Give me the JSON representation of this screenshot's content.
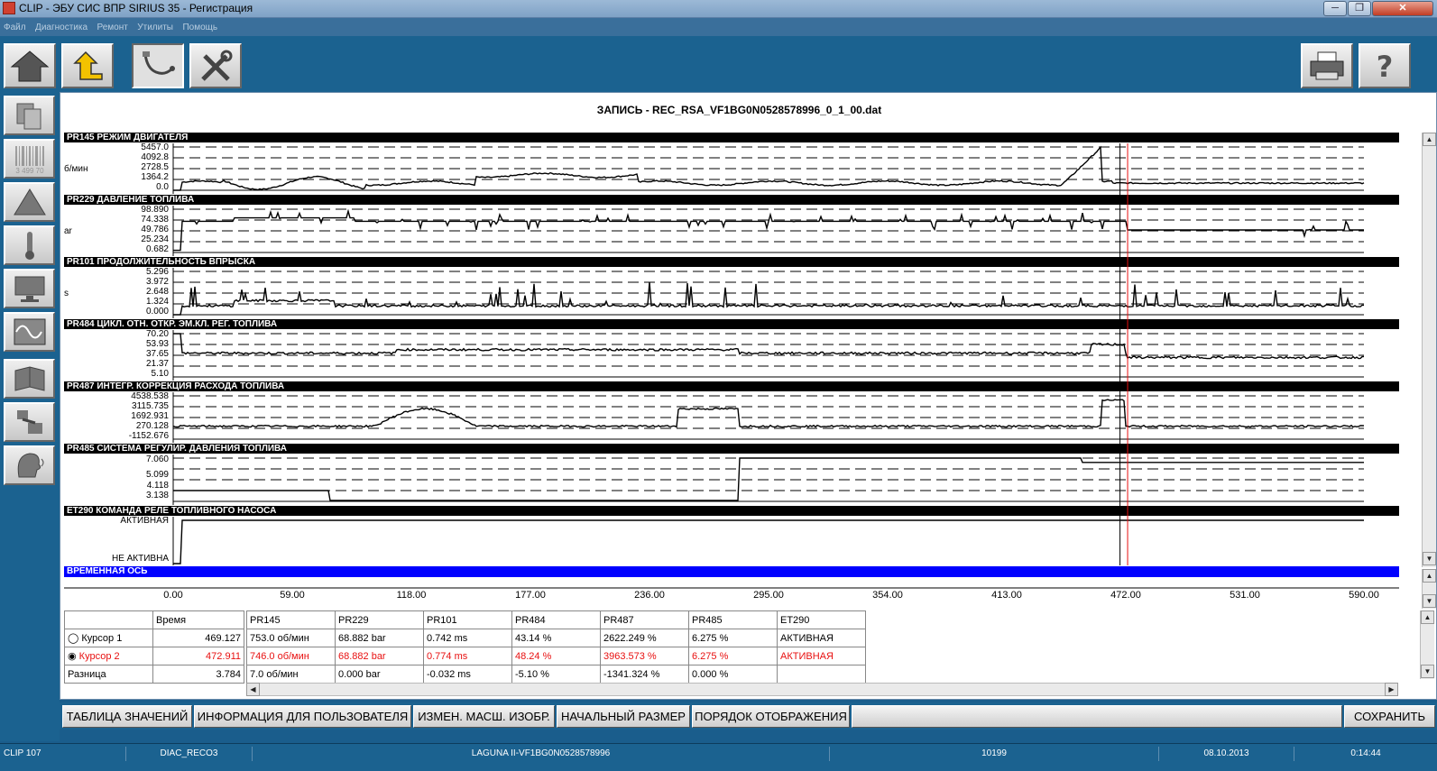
{
  "window": {
    "title": "CLIP - ЭБУ СИС ВПР SIRIUS 35 - Регистрация"
  },
  "menu": [
    "Файл",
    "Диагностика",
    "Ремонт",
    "Утилиты",
    "Помощь"
  ],
  "record_title": "ЗАПИСЬ - REC_RSA_VF1BG0N0528578996_0_1_00.dat",
  "channels": [
    {
      "title": "PR145  РЕЖИМ ДВИГАТЕЛЯ",
      "unit": "б/мин",
      "ticks": [
        "5457.0",
        "4092.8",
        "2728.5",
        "1364.2",
        "0.0"
      ]
    },
    {
      "title": "PR229  ДАВЛЕНИЕ ТОПЛИВА",
      "unit": "ar",
      "ticks": [
        "98.890",
        "74.338",
        "49.786",
        "25.234",
        "0.682"
      ]
    },
    {
      "title": "PR101  ПРОДОЛЖИТЕЛЬНОСТЬ ВПРЫСКА",
      "unit": "s",
      "ticks": [
        "5.296",
        "3.972",
        "2.648",
        "1.324",
        "0.000"
      ]
    },
    {
      "title": "PR484  ЦИКЛ. ОТН. ОТКР. ЭМ.КЛ. РЕГ. ТОПЛИВА",
      "unit": "",
      "ticks": [
        "70.20",
        "53.93",
        "37.65",
        "21.37",
        "5.10"
      ]
    },
    {
      "title": "PR487  ИНТЕГР. КОРРЕКЦИЯ РАСХОДА ТОПЛИВА",
      "unit": "",
      "ticks": [
        "4538.538",
        "3115.735",
        "1692.931",
        "270.128",
        "-1152.676"
      ]
    },
    {
      "title": "PR485  СИСТЕМА РЕГУЛИР. ДАВЛЕНИЯ ТОПЛИВА",
      "unit": "",
      "ticks": [
        "7.060",
        "5.099",
        "4.118",
        "3.138"
      ]
    },
    {
      "title": "ET290  КОМАНДА РЕЛЕ ТОПЛИВНОГО НАСОСА",
      "unit": "",
      "ticks": [
        "АКТИВНАЯ",
        "НЕ АКТИВНА"
      ]
    }
  ],
  "time_axis": {
    "title": "ВРЕМЕННАЯ ОСЬ",
    "ticks": [
      "0.00",
      "59.00",
      "118.00",
      "177.00",
      "236.00",
      "295.00",
      "354.00",
      "413.00",
      "472.00",
      "531.00",
      "590.00"
    ],
    "cursor1": 469.127,
    "cursor2": 472.911
  },
  "table": {
    "time_header": "Время",
    "columns": [
      "PR145",
      "PR229",
      "PR101",
      "PR484",
      "PR487",
      "PR485",
      "ET290"
    ],
    "rows": [
      {
        "label": "Курсор 1",
        "time": "469.127",
        "values": [
          "753.0 об/мин",
          "68.882 bar",
          "0.742 ms",
          "43.14 %",
          "2622.249 %",
          "6.275 %",
          "АКТИВНАЯ"
        ]
      },
      {
        "label": "Курсор 2",
        "time": "472.911",
        "values": [
          "746.0 об/мин",
          "68.882 bar",
          "0.774 ms",
          "48.24 %",
          "3963.573 %",
          "6.275 %",
          "АКТИВНАЯ"
        ]
      },
      {
        "label": "Разница",
        "time": "3.784",
        "values": [
          "7.0 об/мин",
          "0.000 bar",
          "-0.032 ms",
          "-5.10 %",
          "-1341.324 %",
          "0.000 %",
          ""
        ]
      }
    ]
  },
  "buttons": {
    "values_table": "ТАБЛИЦА ЗНАЧЕНИЙ",
    "user_info": "ИНФОРМАЦИЯ ДЛЯ ПОЛЬЗОВАТЕЛЯ",
    "change_scale": "ИЗМЕН. МАСШ. ИЗОБР.",
    "initial_size": "НАЧАЛЬНЫЙ РАЗМЕР",
    "display_order": "ПОРЯДОК ОТОБРАЖЕНИЯ",
    "save": "СОХРАНИТЬ"
  },
  "status": [
    "CLIP 107",
    "DIAC_RECO3",
    "LAGUNA II-VF1BG0N0528578996",
    "10199",
    "08.10.2013",
    "0:14:44"
  ],
  "icons": {
    "toolbar": [
      "home-icon",
      "up-folder-icon",
      "probe-icon",
      "tools-icon",
      "printer-icon",
      "help-icon"
    ],
    "sidebar": [
      "documents-icon",
      "barcode-icon",
      "warning-icon",
      "thermometer-icon",
      "screen-icon",
      "oscilloscope-icon",
      "manual-icon",
      "diagram-icon",
      "voice-icon"
    ]
  },
  "sidebar_barcode_text": "3 499 70"
}
